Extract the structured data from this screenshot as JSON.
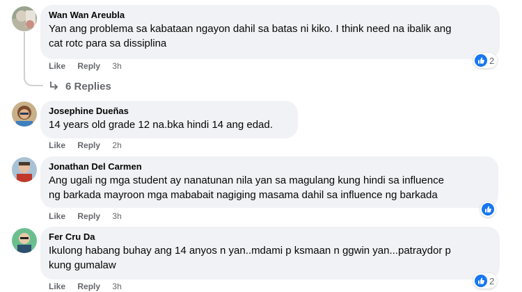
{
  "comments": [
    {
      "author": "Wan Wan Areubla",
      "text_lines": [
        "Yan ang problema sa kabataan ngayon dahil sa batas ni kiko. I think need na ibalik ang",
        "cat rotc para sa dissiplina"
      ],
      "like": "Like",
      "reply": "Reply",
      "time": "3h",
      "reaction_count": "2"
    },
    {
      "author": "Josephine Dueñas",
      "text_lines": [
        "14 years old grade 12 na.bka hindi 14 ang edad."
      ],
      "like": "Like",
      "reply": "Reply",
      "time": "2h"
    },
    {
      "author": "Jonathan Del Carmen",
      "text_lines": [
        "Ang ugali ng mga student ay nanatunan nila yan sa magulang kung hindi sa influence",
        "ng barkada mayroon mga mababait nagiging masama dahil sa influence ng barkada"
      ],
      "like": "Like",
      "reply": "Reply",
      "time": "3h"
    },
    {
      "author": "Fer Cru Da",
      "text_lines": [
        "Ikulong habang buhay ang 14 anyos n yan..mdami p ksmaan n ggwin yan...patraydor p",
        "kung gumalaw"
      ],
      "like": "Like",
      "reply": "Reply",
      "time": "3h",
      "reaction_count": "2"
    }
  ],
  "view_replies": "6 Replies",
  "colors": {
    "bubble": "#f0f2f5",
    "meta_text": "#65676b",
    "like_blue": "#1877f2"
  }
}
